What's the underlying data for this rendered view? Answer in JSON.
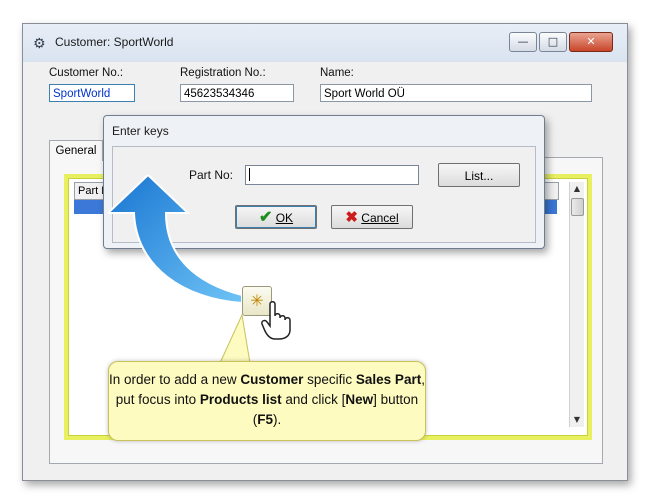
{
  "window": {
    "title": "Customer: SportWorld",
    "minimize_glyph": "—",
    "maximize_glyph": "□",
    "close_glyph": "✕"
  },
  "header": {
    "customer_no_label": "Customer No.:",
    "customer_no_value": "SportWorld",
    "registration_no_label": "Registration No.:",
    "registration_no_value": "45623534346",
    "name_label": "Name:",
    "name_value": "Sport World OÜ"
  },
  "tabs": [
    {
      "label": "General"
    }
  ],
  "grid": {
    "columns": [
      "Part N"
    ]
  },
  "dialog": {
    "title": "Enter keys",
    "part_no_label": "Part No:",
    "part_no_value": "",
    "list_button": "List...",
    "ok_button": "OK",
    "cancel_button": "Cancel"
  },
  "callout": {
    "parts": [
      {
        "text": "In order to add a new ",
        "bold": false
      },
      {
        "text": "Customer",
        "bold": true
      },
      {
        "text": " specific ",
        "bold": false
      },
      {
        "text": "Sales Part",
        "bold": true
      },
      {
        "text": ", put focus into ",
        "bold": false
      },
      {
        "text": "Products list",
        "bold": true
      },
      {
        "text": " and click [",
        "bold": false
      },
      {
        "text": "New",
        "bold": true
      },
      {
        "text": "] button (",
        "bold": false
      },
      {
        "text": "F5",
        "bold": true
      },
      {
        "text": ").",
        "bold": false
      }
    ]
  },
  "colors": {
    "highlight_border": "#e8f060",
    "callout_bg": "#fdfbc0",
    "arrow": "#1f8fe0",
    "selection": "#3b78d8",
    "link_blue": "#0033cc"
  },
  "icons": {
    "app": "app-gear-icon",
    "new_button": "new-record-icon",
    "hand": "hand-pointer-icon",
    "ok": "checkmark-icon",
    "cancel": "x-mark-icon"
  }
}
